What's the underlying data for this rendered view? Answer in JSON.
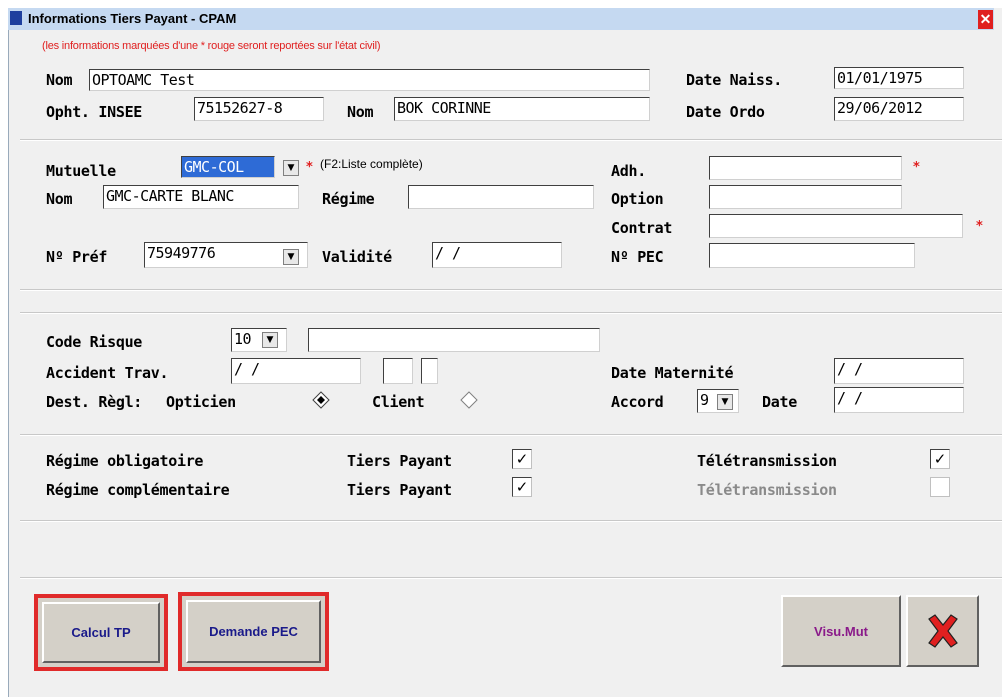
{
  "window": {
    "title": "Informations Tiers Payant - CPAM",
    "close": "✕"
  },
  "note": "(les informations marquées d'une * rouge seront reportées sur l'état civil)",
  "patient": {
    "nom_label": "Nom",
    "nom_value": "OPTOAMC Test",
    "date_naiss_label": "Date Naiss.",
    "date_naiss_value": "01/01/1975",
    "opht_label": "Opht. INSEE",
    "opht_value": "75152627-8",
    "nom2_label": "Nom",
    "nom2_value": "BOK CORINNE",
    "date_ordo_label": "Date Ordo",
    "date_ordo_value": "29/06/2012"
  },
  "mutuelle": {
    "mutuelle_label": "Mutuelle",
    "mutuelle_value": "GMC-COL",
    "star": "*",
    "hint": "(F2:Liste complète)",
    "nom_label": "Nom",
    "nom_value": "GMC-CARTE BLANC",
    "regime_label": "Régime",
    "regime_value": "",
    "npref_label": "Nº Préf",
    "npref_value": "75949776",
    "validite_label": "Validité",
    "validite_value": " /  /",
    "adh_label": "Adh.",
    "adh_value": "",
    "option_label": "Option",
    "option_value": "",
    "contrat_label": "Contrat",
    "contrat_value": "",
    "npec_label": "Nº PEC",
    "npec_value": ""
  },
  "risque": {
    "code_label": "Code Risque",
    "code_value": "10",
    "code_text": "",
    "accident_label": "Accident Trav.",
    "accident_value": " /  /",
    "dest_label": "Dest. Règl:",
    "opticien_label": "Opticien",
    "client_label": "Client",
    "maternite_label": "Date Maternité",
    "maternite_value": " /  /",
    "accord_label": "Accord",
    "accord_value": "9",
    "date_label": "Date",
    "date_value": " /  /"
  },
  "regimes": {
    "oblig_label": "Régime obligatoire",
    "compl_label": "Régime complémentaire",
    "tp_label": "Tiers Payant",
    "tele_label": "Télétransmission",
    "tp1": "✓",
    "tele1": "✓",
    "tp2": "✓",
    "tele2": ""
  },
  "buttons": {
    "calcul": "Calcul TP",
    "demande": "Demande PEC",
    "visu": "Visu.Mut",
    "cancel": "✕"
  },
  "colors": {
    "highlight": "#e02a2a",
    "star": "#e02020",
    "selection": "#2e6bd6"
  }
}
